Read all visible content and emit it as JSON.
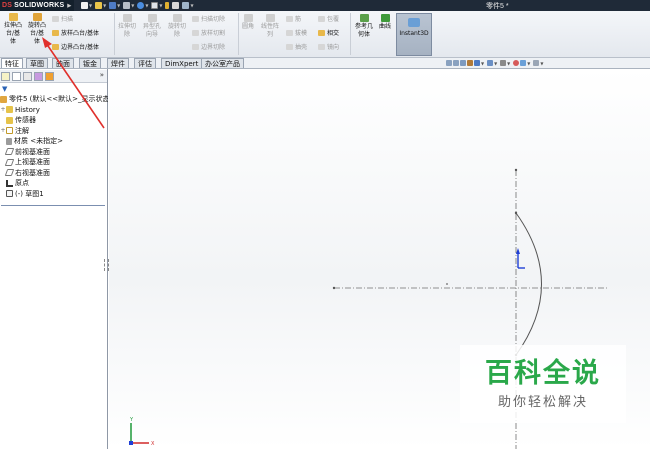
{
  "app": {
    "logo_text": "SOLIDWORKS",
    "logo_mark": "DS",
    "document_title": "零件5 *"
  },
  "quick_access": [
    {
      "icon": "new-document-icon"
    },
    {
      "icon": "open-folder-icon"
    },
    {
      "icon": "save-icon"
    },
    {
      "icon": "print-icon"
    },
    {
      "icon": "undo-icon"
    },
    {
      "icon": "select-cursor-icon"
    },
    {
      "icon": "rebuild-icon"
    },
    {
      "icon": "file-properties-icon"
    },
    {
      "icon": "options-icon"
    }
  ],
  "ribbon": {
    "extrude_boss": "拉伸凸\n台/基\n体",
    "revolve_boss": "旋转凸\n台/基\n体",
    "sweep": "扫描",
    "loft_boss": "放样凸台/基体",
    "boundary_boss": "边界凸台/基体",
    "extruded_cut": "拉伸切\n除",
    "hole_wizard": "异型孔\n向导",
    "revolved_cut": "旋转切\n除",
    "swept_cut": "扫描切除",
    "lofted_cut": "放样切割",
    "boundary_cut": "边界切除",
    "fillet": "圆角",
    "linear_pattern": "线性阵\n列",
    "rib": "筋",
    "draft": "拔模",
    "shell": "抽壳",
    "wrap": "包覆",
    "intersect": "相交",
    "mirror": "镜向",
    "reference_geometry": "参考几\n何体",
    "curves": "曲线",
    "instant3d": "Instant3D"
  },
  "tabs": [
    "特征",
    "草图",
    "曲面",
    "钣金",
    "焊件",
    "评估",
    "DimXpert",
    "办公室产品"
  ],
  "active_tab": 0,
  "feature_tree": {
    "root": "零件5 (默认<<默认>_显示状态",
    "items": [
      {
        "label": "History",
        "icon": "history-folder-icon"
      },
      {
        "label": "传感器",
        "icon": "sensor-icon"
      },
      {
        "label": "注解",
        "icon": "annotations-icon"
      },
      {
        "label": "材质 <未指定>",
        "icon": "material-icon"
      },
      {
        "label": "前视基准面",
        "icon": "plane-icon"
      },
      {
        "label": "上视基准面",
        "icon": "plane-icon"
      },
      {
        "label": "右视基准面",
        "icon": "plane-icon"
      },
      {
        "label": "原点",
        "icon": "origin-icon"
      },
      {
        "label": "(-) 草图1",
        "icon": "sketch-icon"
      }
    ]
  },
  "panel_more": "»",
  "triad": {
    "x_label": "X",
    "y_label": "Y"
  },
  "watermark": {
    "main": "百科全说",
    "sub": "助你轻松解决"
  },
  "colors": {
    "titlebar": "#1f2a38",
    "ribbon": "#eef1f5",
    "arrow": "#e0302c",
    "watermark_green": "#2aa84a",
    "axis_blue": "#1f3fd6"
  }
}
